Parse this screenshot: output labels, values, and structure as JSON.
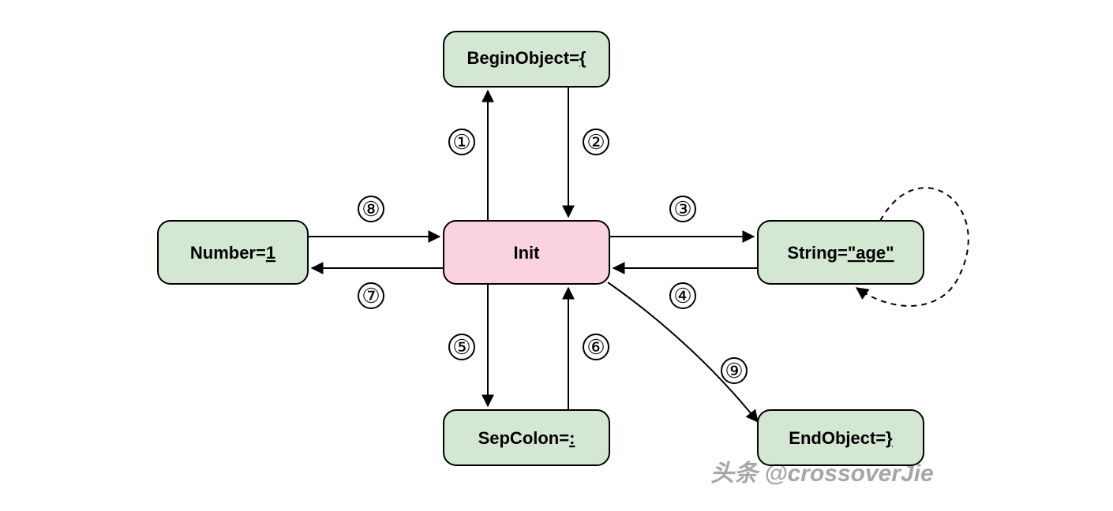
{
  "diagram": {
    "nodes": {
      "begin_object": {
        "label_prefix": "BeginObject=",
        "label_value": "{",
        "box_color": "green"
      },
      "init": {
        "label_prefix": "",
        "label_value": "Init",
        "box_color": "pink"
      },
      "number": {
        "label_prefix": "Number=",
        "label_value": "1",
        "box_color": "green"
      },
      "string": {
        "label_prefix": "String=",
        "label_value": "\"age\"",
        "box_color": "green"
      },
      "sep_colon": {
        "label_prefix": "SepColon=",
        "label_value": ":",
        "box_color": "green"
      },
      "end_object": {
        "label_prefix": "EndObject=",
        "label_value": "}",
        "box_color": "green"
      }
    },
    "edge_glyphs": {
      "e1": "①",
      "e2": "②",
      "e3": "③",
      "e4": "④",
      "e5": "⑤",
      "e6": "⑥",
      "e7": "⑦",
      "e8": "⑧",
      "e9": "⑨"
    },
    "edges_description": [
      {
        "id": 1,
        "from": "init",
        "to": "begin_object"
      },
      {
        "id": 2,
        "from": "begin_object",
        "to": "init"
      },
      {
        "id": 3,
        "from": "init",
        "to": "string"
      },
      {
        "id": 4,
        "from": "string",
        "to": "init"
      },
      {
        "id": 5,
        "from": "init",
        "to": "sep_colon"
      },
      {
        "id": 6,
        "from": "sep_colon",
        "to": "init"
      },
      {
        "id": 7,
        "from": "init",
        "to": "number"
      },
      {
        "id": 8,
        "from": "number",
        "to": "init"
      },
      {
        "id": 9,
        "from": "init",
        "to": "end_object"
      },
      {
        "id": "loop",
        "from": "string",
        "to": "string",
        "dashed": true
      }
    ],
    "watermark": "头条 @crossoverJie"
  }
}
